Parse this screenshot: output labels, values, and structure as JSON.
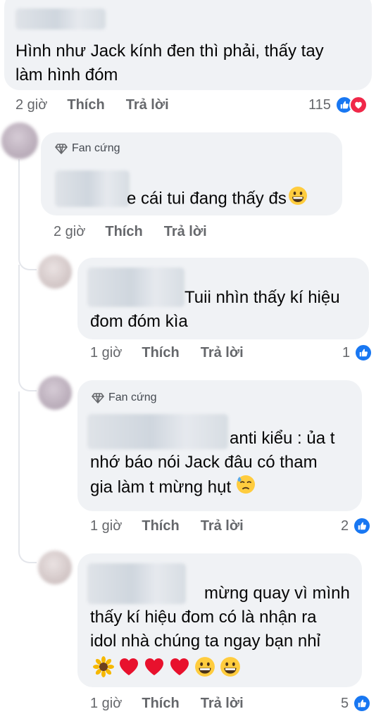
{
  "comments": [
    {
      "text_lines": [
        "Hình như Jack kính đen thì phải, thấy tay",
        "làm hình đóm"
      ],
      "time": "2 giờ",
      "like_label": "Thích",
      "reply_label": "Trả lời",
      "reaction_count": "115",
      "reactions": [
        "like-icon",
        "love-icon"
      ]
    },
    {
      "badge": "Fan cứng",
      "text_lines": [
        "e cái tui đang thấy đs"
      ],
      "time": "2 giờ",
      "like_label": "Thích",
      "reply_label": "Trả lời"
    },
    {
      "text_lines": [
        "Tuii nhìn thấy kí hiệu",
        "đom đóm kìa"
      ],
      "time": "1 giờ",
      "like_label": "Thích",
      "reply_label": "Trả lời",
      "reaction_count": "1",
      "reactions": [
        "like-icon"
      ]
    },
    {
      "badge": "Fan cứng",
      "text_lines": [
        "anti kiểu : ủa t",
        "nhớ báo nói Jack đâu có tham",
        "gia làm t mừng hụt"
      ],
      "time": "1 giờ",
      "like_label": "Thích",
      "reply_label": "Trả lời",
      "reaction_count": "2",
      "reactions": [
        "like-icon"
      ]
    },
    {
      "text_lines": [
        "mừng quay vì mình",
        "thấy kí hiệu đom có là nhận ra",
        "idol nhà chúng ta ngay bạn nhỉ"
      ],
      "time": "1 giờ",
      "like_label": "Thích",
      "reply_label": "Trả lời",
      "reaction_count": "5",
      "reactions": [
        "like-icon"
      ]
    }
  ],
  "colors": {
    "bubble": "#f0f2f5",
    "meta_text": "#65676b",
    "like_blue": "#1877f2",
    "love_red": "#f02849"
  }
}
